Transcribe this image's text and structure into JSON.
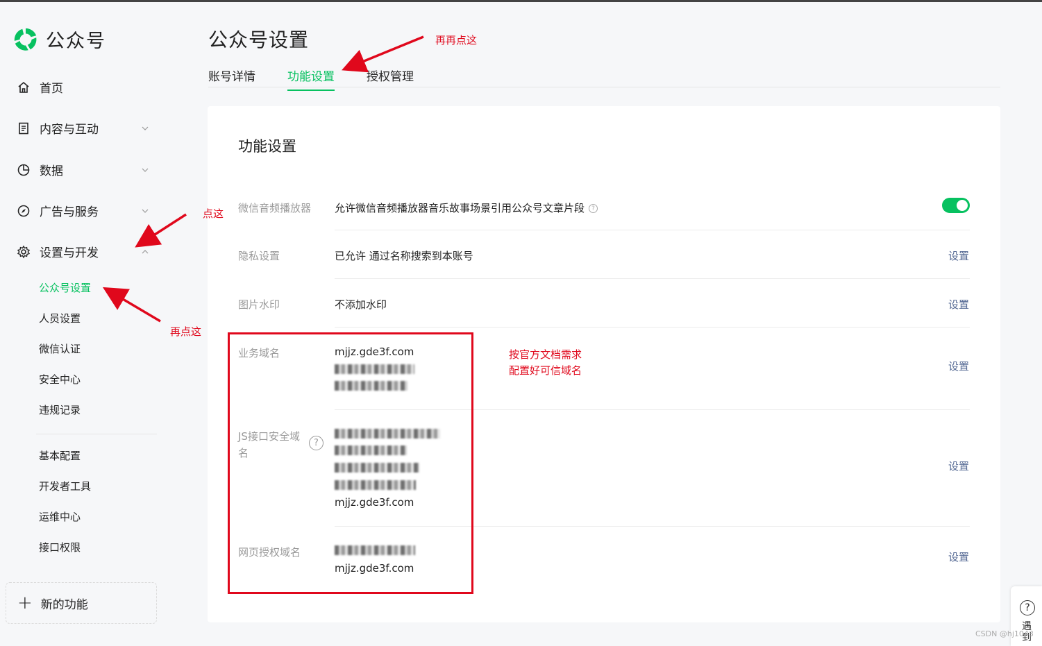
{
  "app": {
    "logo_text": "公众号"
  },
  "sidebar": {
    "items": [
      {
        "label": "首页",
        "icon": "home-icon"
      },
      {
        "label": "内容与互动",
        "icon": "document-icon"
      },
      {
        "label": "数据",
        "icon": "pie-chart-icon"
      },
      {
        "label": "广告与服务",
        "icon": "compass-icon"
      },
      {
        "label": "设置与开发",
        "icon": "gear-icon"
      }
    ],
    "sub_items": [
      {
        "label": "公众号设置",
        "active": true
      },
      {
        "label": "人员设置"
      },
      {
        "label": "微信认证"
      },
      {
        "label": "安全中心"
      },
      {
        "label": "违规记录"
      },
      {
        "label": "基本配置"
      },
      {
        "label": "开发者工具"
      },
      {
        "label": "运维中心"
      },
      {
        "label": "接口权限"
      }
    ],
    "new_func": "新的功能"
  },
  "main": {
    "title": "公众号设置",
    "tabs": [
      {
        "label": "账号详情"
      },
      {
        "label": "功能设置",
        "active": true
      },
      {
        "label": "授权管理"
      }
    ],
    "card_title": "功能设置",
    "rows": [
      {
        "label": "微信音频播放器",
        "value": "允许微信音频播放器音乐故事场景引用公众号文章片段",
        "toggle": true
      },
      {
        "label": "隐私设置",
        "value": "已允许 通过名称搜索到本账号",
        "link": "设置"
      },
      {
        "label": "图片水印",
        "value": "不添加水印",
        "link": "设置"
      },
      {
        "label": "业务域名",
        "value": "mjjz.gde3f.com",
        "link": "设置"
      },
      {
        "label": "JS接口安全域名",
        "value": "mjjz.gde3f.com",
        "link": "设置"
      },
      {
        "label": "网页授权域名",
        "value": "mjjz.gde3f.com",
        "link": "设置"
      }
    ]
  },
  "annotations": {
    "again_again": "再再点这",
    "click_here": "点这",
    "again_here": "再点这",
    "note_line1": "按官方文档需求",
    "note_line2": "配置好可信域名",
    "accent": "#e0081c"
  },
  "help": {
    "q": "?",
    "text": "遇到"
  },
  "watermark": "CSDN @hj1043",
  "colors": {
    "brand": "#07c160",
    "link": "#576b95"
  }
}
